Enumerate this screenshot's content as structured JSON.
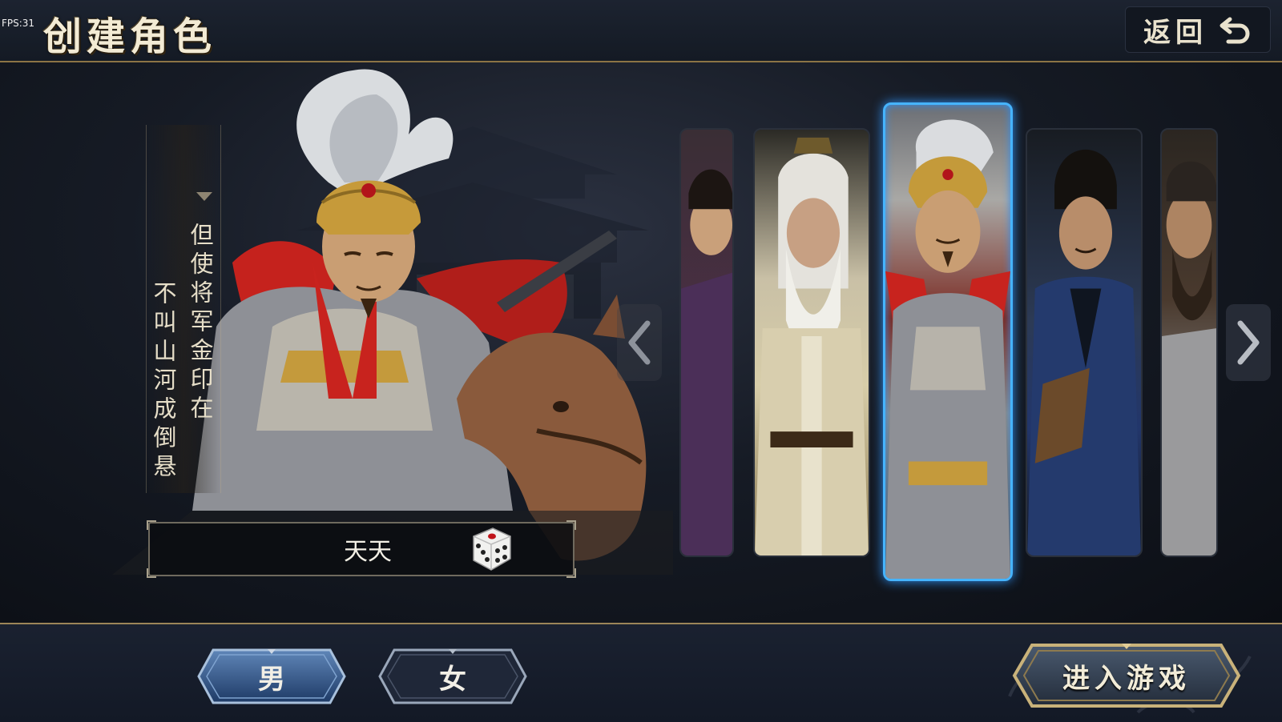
{
  "hud": {
    "fps": "FPS:31"
  },
  "header": {
    "title": "创建角色",
    "back_label": "返回"
  },
  "poem": {
    "line1": "但使将军金印在",
    "line2": "不叫山河成倒悬"
  },
  "name": {
    "value": "天天"
  },
  "portraits": [
    {
      "id": "partial-left",
      "selected": false
    },
    {
      "id": "elder",
      "selected": false
    },
    {
      "id": "armored-general",
      "selected": true
    },
    {
      "id": "blue-robe",
      "selected": false
    },
    {
      "id": "partial-right",
      "selected": false
    }
  ],
  "gender": {
    "male_label": "男",
    "female_label": "女",
    "selected": "男"
  },
  "actions": {
    "enter_label": "进入游戏"
  },
  "colors": {
    "accent_selected": "#46b4ff",
    "gold_border": "#9c8558"
  }
}
